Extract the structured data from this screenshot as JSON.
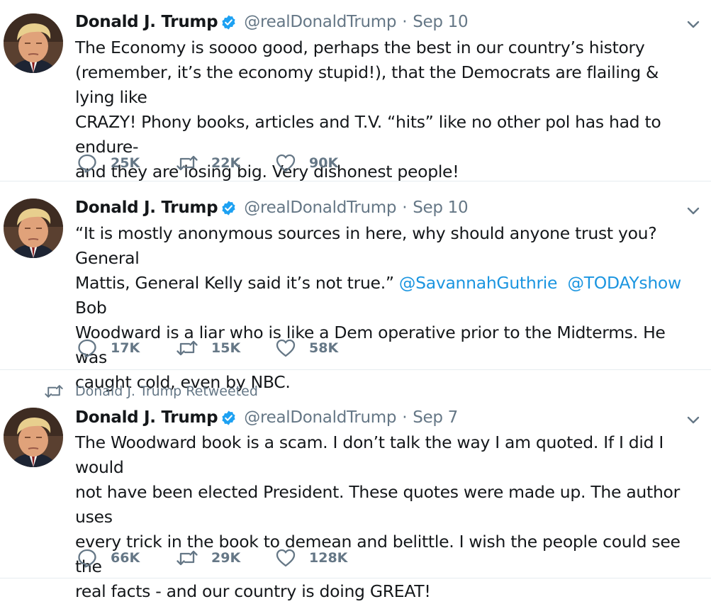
{
  "colors": {
    "text": "#14171a",
    "muted": "#657786",
    "link": "#1b95e0",
    "verified": "#1da1f2",
    "divider": "#e6ecf0"
  },
  "icons": {
    "reply": "reply-icon",
    "retweet": "retweet-icon",
    "like": "heart-icon",
    "verified": "verified-badge-icon",
    "caret": "chevron-down-icon"
  },
  "tweets": [
    {
      "name": "Donald J. Trump",
      "handle": "@realDonaldTrump",
      "separator": "·",
      "date": "Sep 10",
      "text_lines": [
        "The Economy is soooo good, perhaps the best in our country’s history",
        "(remember, it’s the economy stupid!), that the Democrats are flailing & lying like",
        "CRAZY! Phony books, articles and T.V. “hits” like no other pol has had to endure-",
        "and they are losing big. Very dishonest people!"
      ],
      "replies": "25K",
      "retweets": "22K",
      "likes": "90K"
    },
    {
      "name": "Donald J. Trump",
      "handle": "@realDonaldTrump",
      "separator": "·",
      "date": "Sep 10",
      "text_line1": "“It is mostly anonymous sources in here, why should anyone trust you? General",
      "text_line2_pre": "Mattis, General Kelly said it’s not true.” ",
      "mention1": "@SavannahGuthrie",
      "mention2": "@TODAYshow",
      "text_line2_post": " Bob",
      "text_line3": "Woodward is a liar who is like a Dem operative prior to the Midterms. He was",
      "text_line4": "caught cold, even by NBC.",
      "replies": "17K",
      "retweets": "15K",
      "likes": "58K"
    },
    {
      "retweeted_by": "Donald J. Trump Retweeted",
      "name": "Donald J. Trump",
      "handle": "@realDonaldTrump",
      "separator": "·",
      "date": "Sep 7",
      "text_lines": [
        "The Woodward book is a scam. I don’t talk the way I am quoted. If I did I would",
        "not have been elected President. These quotes were made up. The author uses",
        "every trick in the book to demean and belittle. I wish the people could see the",
        "real facts - and our country is doing GREAT!"
      ],
      "replies": "66K",
      "retweets": "29K",
      "likes": "128K"
    }
  ]
}
